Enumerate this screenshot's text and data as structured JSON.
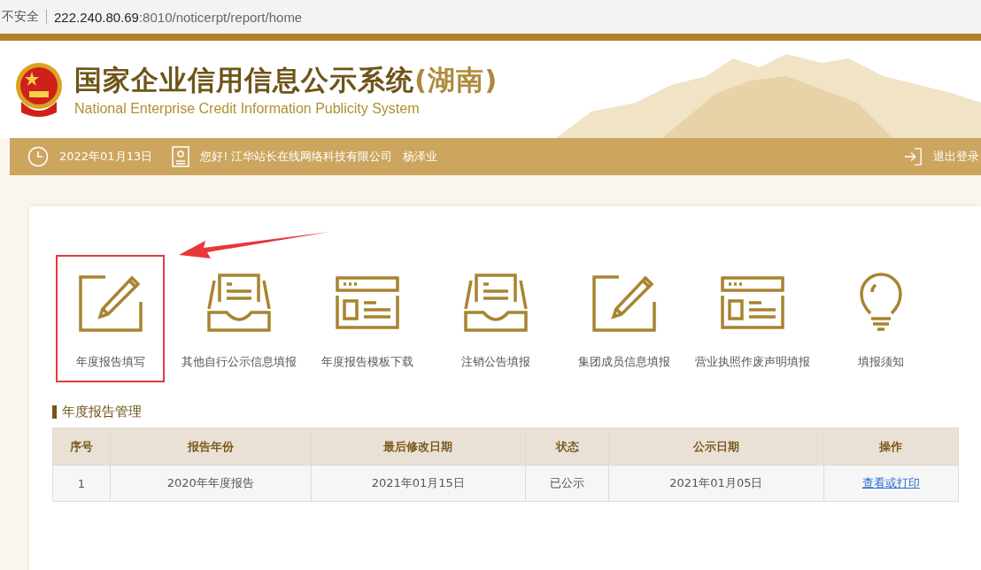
{
  "browser": {
    "security": "不安全",
    "url_host": "222.240.80.69",
    "url_path": ":8010/noticerpt/report/home"
  },
  "header": {
    "title": "国家企业信用信息公示系统",
    "region": "(湖南)",
    "subtitle": "National Enterprise Credit Information Publicity System"
  },
  "user_bar": {
    "date": "2022年01月13日",
    "greeting": "您好!",
    "company": "江华站长在线网络科技有限公司",
    "user": "杨泽业",
    "logout": "退出登录"
  },
  "tiles": [
    {
      "kind": "pencil",
      "label": "年度报告填写",
      "highlighted": true
    },
    {
      "kind": "tray",
      "label": "其他自行公示信息填报",
      "highlighted": false
    },
    {
      "kind": "window",
      "label": "年度报告模板下载",
      "highlighted": false
    },
    {
      "kind": "tray",
      "label": "注销公告填报",
      "highlighted": false
    },
    {
      "kind": "pencil",
      "label": "集团成员信息填报",
      "highlighted": false
    },
    {
      "kind": "window",
      "label": "营业执照作废声明填报",
      "highlighted": false
    },
    {
      "kind": "bulb",
      "label": "填报须知",
      "highlighted": false
    }
  ],
  "section_title": "年度报告管理",
  "table": {
    "columns": [
      "序号",
      "报告年份",
      "最后修改日期",
      "状态",
      "公示日期",
      "操作"
    ],
    "rows": [
      {
        "cells": [
          "1",
          "2020年年度报告",
          "2021年01月15日",
          "已公示",
          "2021年01月05日"
        ],
        "action": "查看或打印"
      }
    ]
  }
}
